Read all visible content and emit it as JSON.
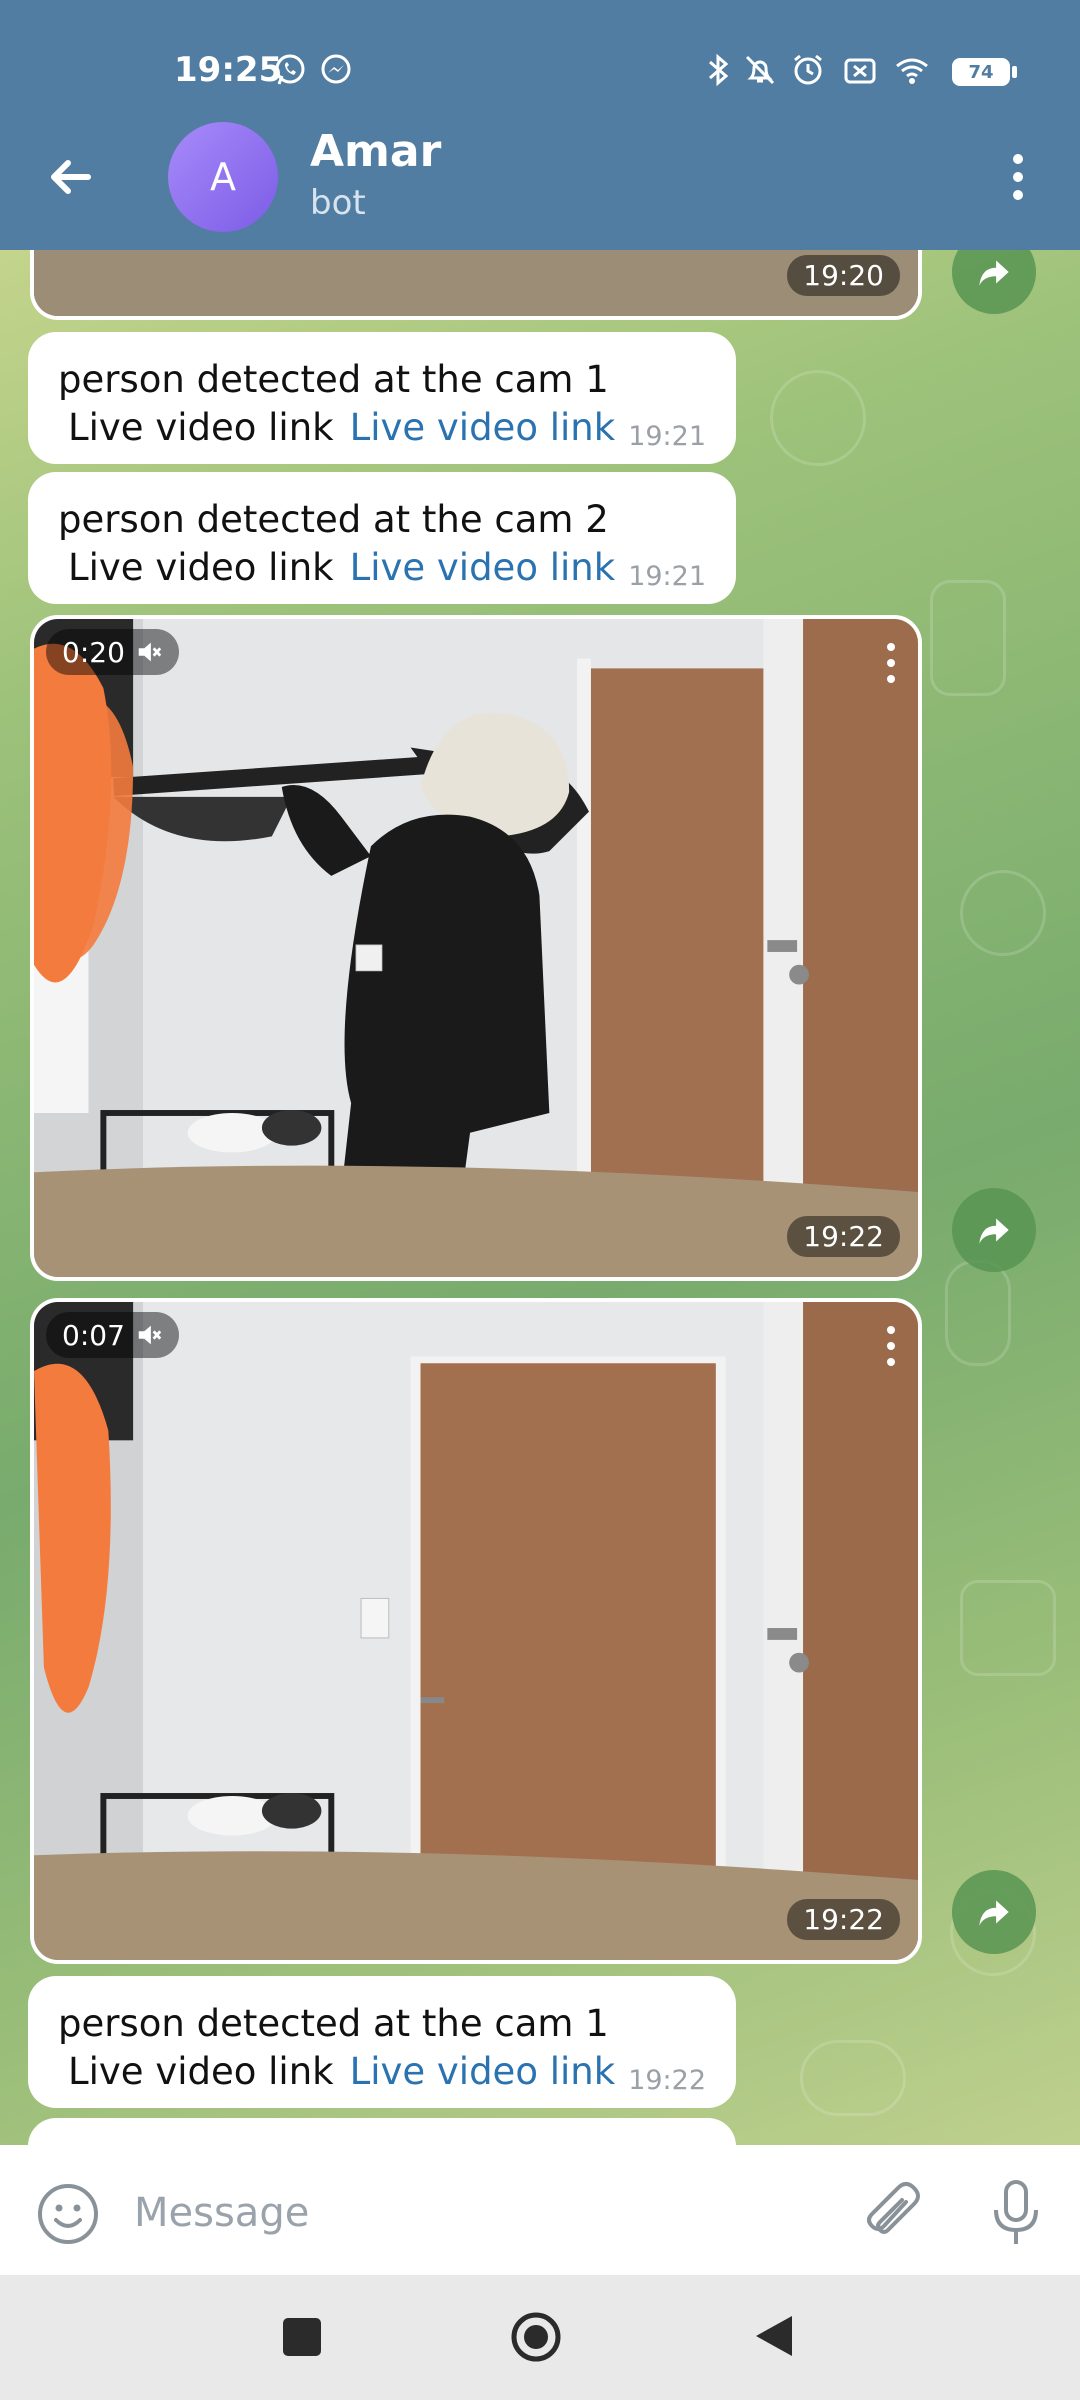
{
  "status_bar": {
    "time": "19:25",
    "battery": "74",
    "icons": [
      "whatsapp-icon",
      "messenger-icon",
      "bluetooth-icon",
      "muted-bell-icon",
      "alarm-icon",
      "no-sim-icon",
      "wifi-icon",
      "battery-icon"
    ]
  },
  "header": {
    "avatar_letter": "A",
    "title": "Amar",
    "subtitle": "bot"
  },
  "messages": [
    {
      "type": "video",
      "time": "19:20"
    },
    {
      "type": "text",
      "line1": "person detected at the cam 1",
      "line2": "Live video link",
      "link": "Live video link",
      "time": "19:21"
    },
    {
      "type": "text",
      "line1": "person detected at the cam 2",
      "line2": "Live video link",
      "link": "Live video link",
      "time": "19:21"
    },
    {
      "type": "video",
      "duration": "0:20",
      "time": "19:22"
    },
    {
      "type": "video",
      "duration": "0:07",
      "time": "19:22"
    },
    {
      "type": "text",
      "line1": "person detected at the cam 1",
      "line2": "Live video link",
      "link": "Live video link",
      "time": "19:22"
    }
  ],
  "input": {
    "placeholder": "Message"
  },
  "colors": {
    "header": "#517da2",
    "link": "#2a73b0",
    "bubble": "#ffffff",
    "avatar": "#8b6cf0",
    "redaction": "#f47b3e"
  }
}
